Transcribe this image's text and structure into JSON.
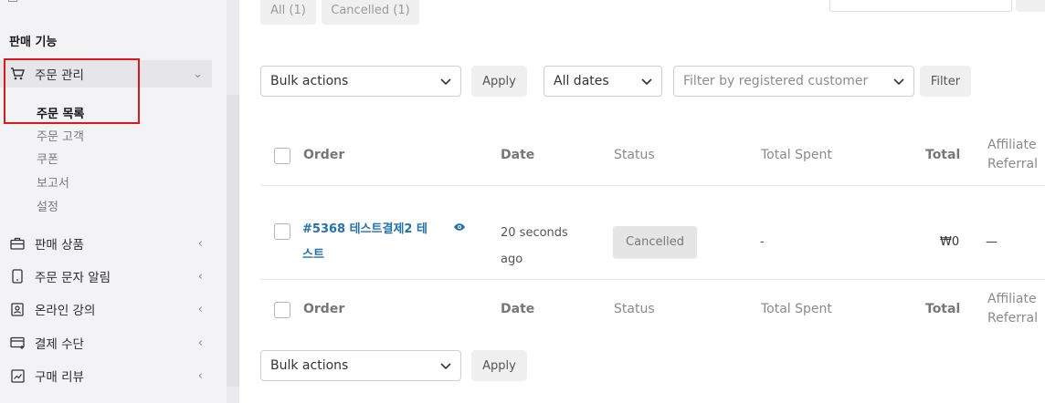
{
  "sidebar": {
    "top_cut_label": "",
    "section_title": "판매 기능",
    "orders_menu": {
      "label": "주문 관리",
      "icon": "cart-icon"
    },
    "sub_items": [
      {
        "label": "주문 목록",
        "current": true
      },
      {
        "label": "주문 고객"
      },
      {
        "label": "쿠폰"
      },
      {
        "label": "보고서"
      },
      {
        "label": "설정"
      }
    ],
    "menus": [
      {
        "label": "판매 상품",
        "icon": "briefcase-icon"
      },
      {
        "label": "주문 문자 알림",
        "icon": "phone-icon"
      },
      {
        "label": "온라인 강의",
        "icon": "id-card-icon"
      },
      {
        "label": "결제 수단",
        "icon": "card-icon"
      },
      {
        "label": "구매 리뷰",
        "icon": "review-icon"
      }
    ]
  },
  "status_filters": {
    "all": "All (1)",
    "cancelled": "Cancelled (1)"
  },
  "top_toolbar": {
    "bulk_actions": "Bulk actions",
    "apply": "Apply",
    "dates": "All dates",
    "customer_placeholder": "Filter by registered customer",
    "filter": "Filter"
  },
  "table": {
    "headers": {
      "order": "Order",
      "date": "Date",
      "status": "Status",
      "total_spent": "Total Spent",
      "total": "Total",
      "affiliate_1": "Affiliate",
      "affiliate_2": "Referral"
    },
    "rows": [
      {
        "order_line1": "#5368 테스트결제2 테",
        "order_line2": "스트",
        "date_line1": "20 seconds",
        "date_line2": "ago",
        "status": "Cancelled",
        "total_spent": "-",
        "total": "₩0",
        "affiliate": "—"
      }
    ]
  },
  "bottom_toolbar": {
    "bulk_actions": "Bulk actions",
    "apply": "Apply"
  },
  "colors": {
    "link": "#2271b1",
    "highlight_box": "#e0161b"
  }
}
